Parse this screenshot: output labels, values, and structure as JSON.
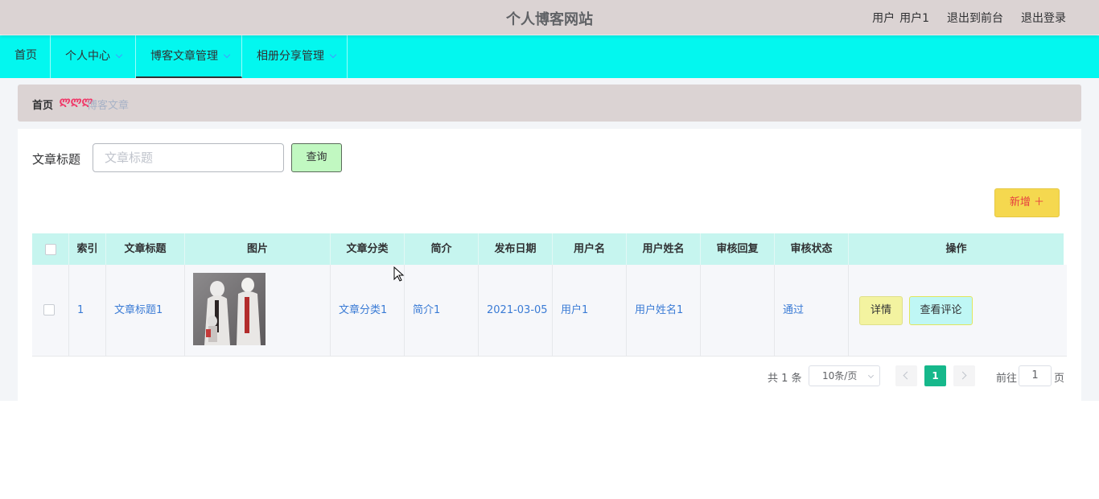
{
  "header": {
    "site_title": "个人博客网站",
    "user_label": "用户",
    "user_name": "用户1",
    "back_to_front": "退出到前台",
    "logout": "退出登录"
  },
  "nav": {
    "items": [
      {
        "label": "首页",
        "has_dropdown": false
      },
      {
        "label": "个人中心",
        "has_dropdown": true
      },
      {
        "label": "博客文章管理",
        "has_dropdown": true,
        "active": true
      },
      {
        "label": "相册分享管理",
        "has_dropdown": true
      }
    ]
  },
  "breadcrumb": {
    "home": "首页",
    "separator": "ლლლ",
    "current": "博客文章"
  },
  "search": {
    "label": "文章标题",
    "placeholder": "文章标题",
    "value": "",
    "query_button": "查询"
  },
  "toolbar": {
    "add_button": "新增 ＋"
  },
  "table": {
    "columns": [
      "索引",
      "文章标题",
      "图片",
      "文章分类",
      "简介",
      "发布日期",
      "用户名",
      "用户姓名",
      "审核回复",
      "审核状态",
      "操作"
    ],
    "rows": [
      {
        "index": "1",
        "title": "文章标题1",
        "image": "article-thumbnail",
        "category": "文章分类1",
        "intro": "简介1",
        "date": "2021-03-05",
        "username": "用户1",
        "fullname": "用户姓名1",
        "review_reply": "",
        "review_status": "通过",
        "actions": {
          "detail": "详情",
          "comments": "查看评论"
        }
      }
    ]
  },
  "pagination": {
    "total": "共 1 条",
    "page_size": "10条/页",
    "current_page": "1",
    "goto_label": "前往",
    "goto_value": "1",
    "page_suffix": "页"
  },
  "colors": {
    "topbar": "#dbd3d3",
    "navbar": "#03f7ef",
    "table_header": "#c6f5ef",
    "link_blue": "#3a7bd5",
    "add_button": "#f5d84f",
    "query_button": "#c1f8c1",
    "active_page": "#16b88b"
  }
}
